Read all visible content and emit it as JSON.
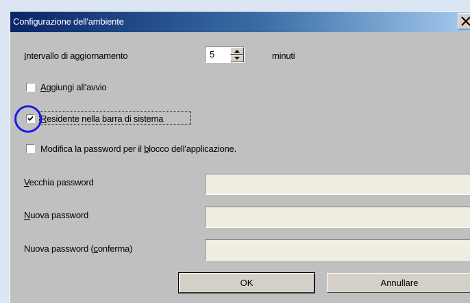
{
  "window": {
    "title": "Configurazione dell'ambiente"
  },
  "update_interval": {
    "label": "Intervallo di aggiornamento",
    "value": "5",
    "unit": "minuti"
  },
  "options": [
    {
      "label": "Aggiungi all'avvio",
      "checked": false
    },
    {
      "label": "Residente nella barra di sistema",
      "checked": true
    },
    {
      "label": "Modifica la password per il blocco dell'applicazione.",
      "checked": false
    }
  ],
  "fields": [
    {
      "label": "Vecchia password",
      "value": ""
    },
    {
      "label": "Nuova password",
      "value": ""
    },
    {
      "label": "Nuova password (conferma)",
      "value": ""
    }
  ],
  "buttons": {
    "ok": "OK",
    "cancel": "Annullare"
  },
  "icons": {
    "close": "close-icon",
    "spin_up": "arrow-up-icon",
    "spin_down": "arrow-down-icon",
    "check": "checkmark-icon"
  },
  "colors": {
    "title_start": "#0a246a",
    "title_end": "#a6caf0",
    "highlight_ring": "#1a1ae6",
    "dialog_face": "#c0c0c0",
    "disabled_field": "#f0ede2"
  }
}
